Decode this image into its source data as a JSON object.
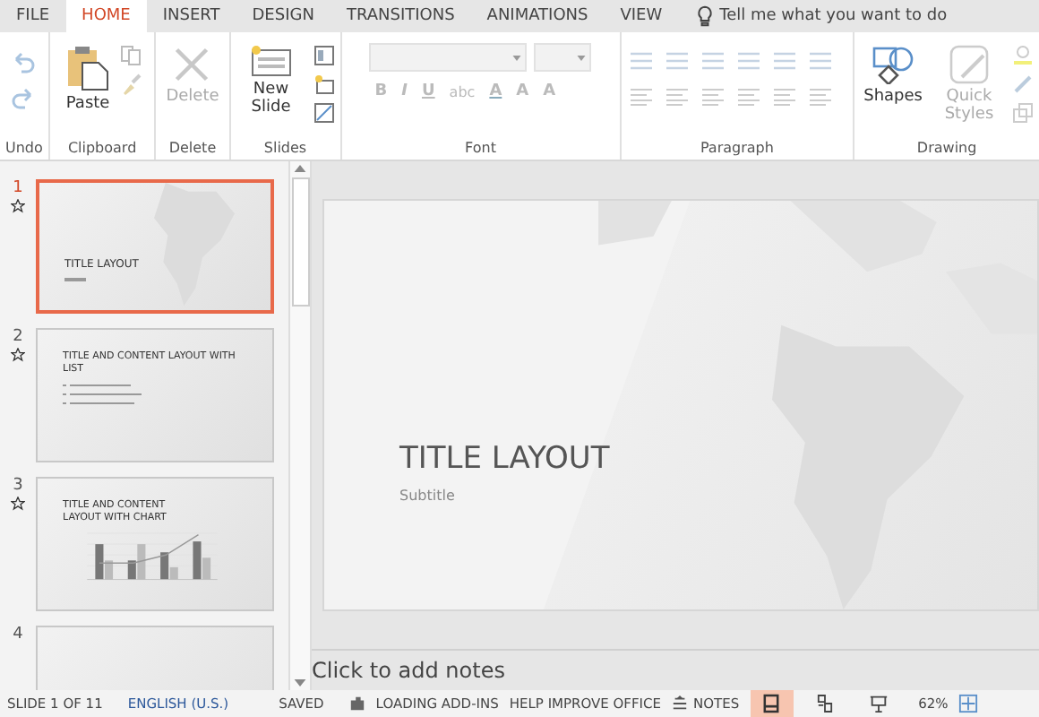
{
  "tabs": [
    {
      "label": "FILE",
      "selected": false
    },
    {
      "label": "HOME",
      "selected": true
    },
    {
      "label": "INSERT",
      "selected": false
    },
    {
      "label": "DESIGN",
      "selected": false
    },
    {
      "label": "TRANSITIONS",
      "selected": false
    },
    {
      "label": "ANIMATIONS",
      "selected": false
    },
    {
      "label": "VIEW",
      "selected": false
    }
  ],
  "tell_me": "Tell me what you want to do",
  "ribbon": {
    "undo": {
      "label": "Undo"
    },
    "clipboard": {
      "label": "Clipboard",
      "paste": "Paste"
    },
    "delete": {
      "label": "Delete",
      "button": "Delete"
    },
    "slides": {
      "label": "Slides",
      "new_slide": "New Slide"
    },
    "font": {
      "label": "Font",
      "buttons": [
        "B",
        "I",
        "U",
        "abc",
        "A",
        "A",
        "A"
      ]
    },
    "paragraph": {
      "label": "Paragraph"
    },
    "drawing": {
      "label": "Drawing",
      "shapes": "Shapes",
      "quick_styles": "Quick Styles"
    }
  },
  "slides": [
    {
      "number": "1",
      "kind": "title",
      "title": "TITLE LAYOUT",
      "selected": true
    },
    {
      "number": "2",
      "kind": "list",
      "title": "TITLE AND CONTENT LAYOUT WITH LIST",
      "selected": false
    },
    {
      "number": "3",
      "kind": "chart",
      "title": "TITLE AND CONTENT LAYOUT WITH CHART",
      "selected": false
    },
    {
      "number": "4",
      "kind": "blank",
      "selected": false
    }
  ],
  "slide": {
    "title": "TITLE LAYOUT",
    "subtitle": "Subtitle"
  },
  "notes": {
    "placeholder": "Click to add notes"
  },
  "status_bar": {
    "slide": "SLIDE 1 OF 11",
    "language": "ENGLISH (U.S.)",
    "save_state": "SAVED",
    "addins": "LOADING ADD-INS",
    "help": "HELP IMPROVE OFFICE",
    "notes": "NOTES",
    "zoom": "62%",
    "views": [
      {
        "kind": "normal",
        "selected": true
      },
      {
        "kind": "sorter",
        "selected": false
      },
      {
        "kind": "reading",
        "selected": false
      }
    ]
  }
}
